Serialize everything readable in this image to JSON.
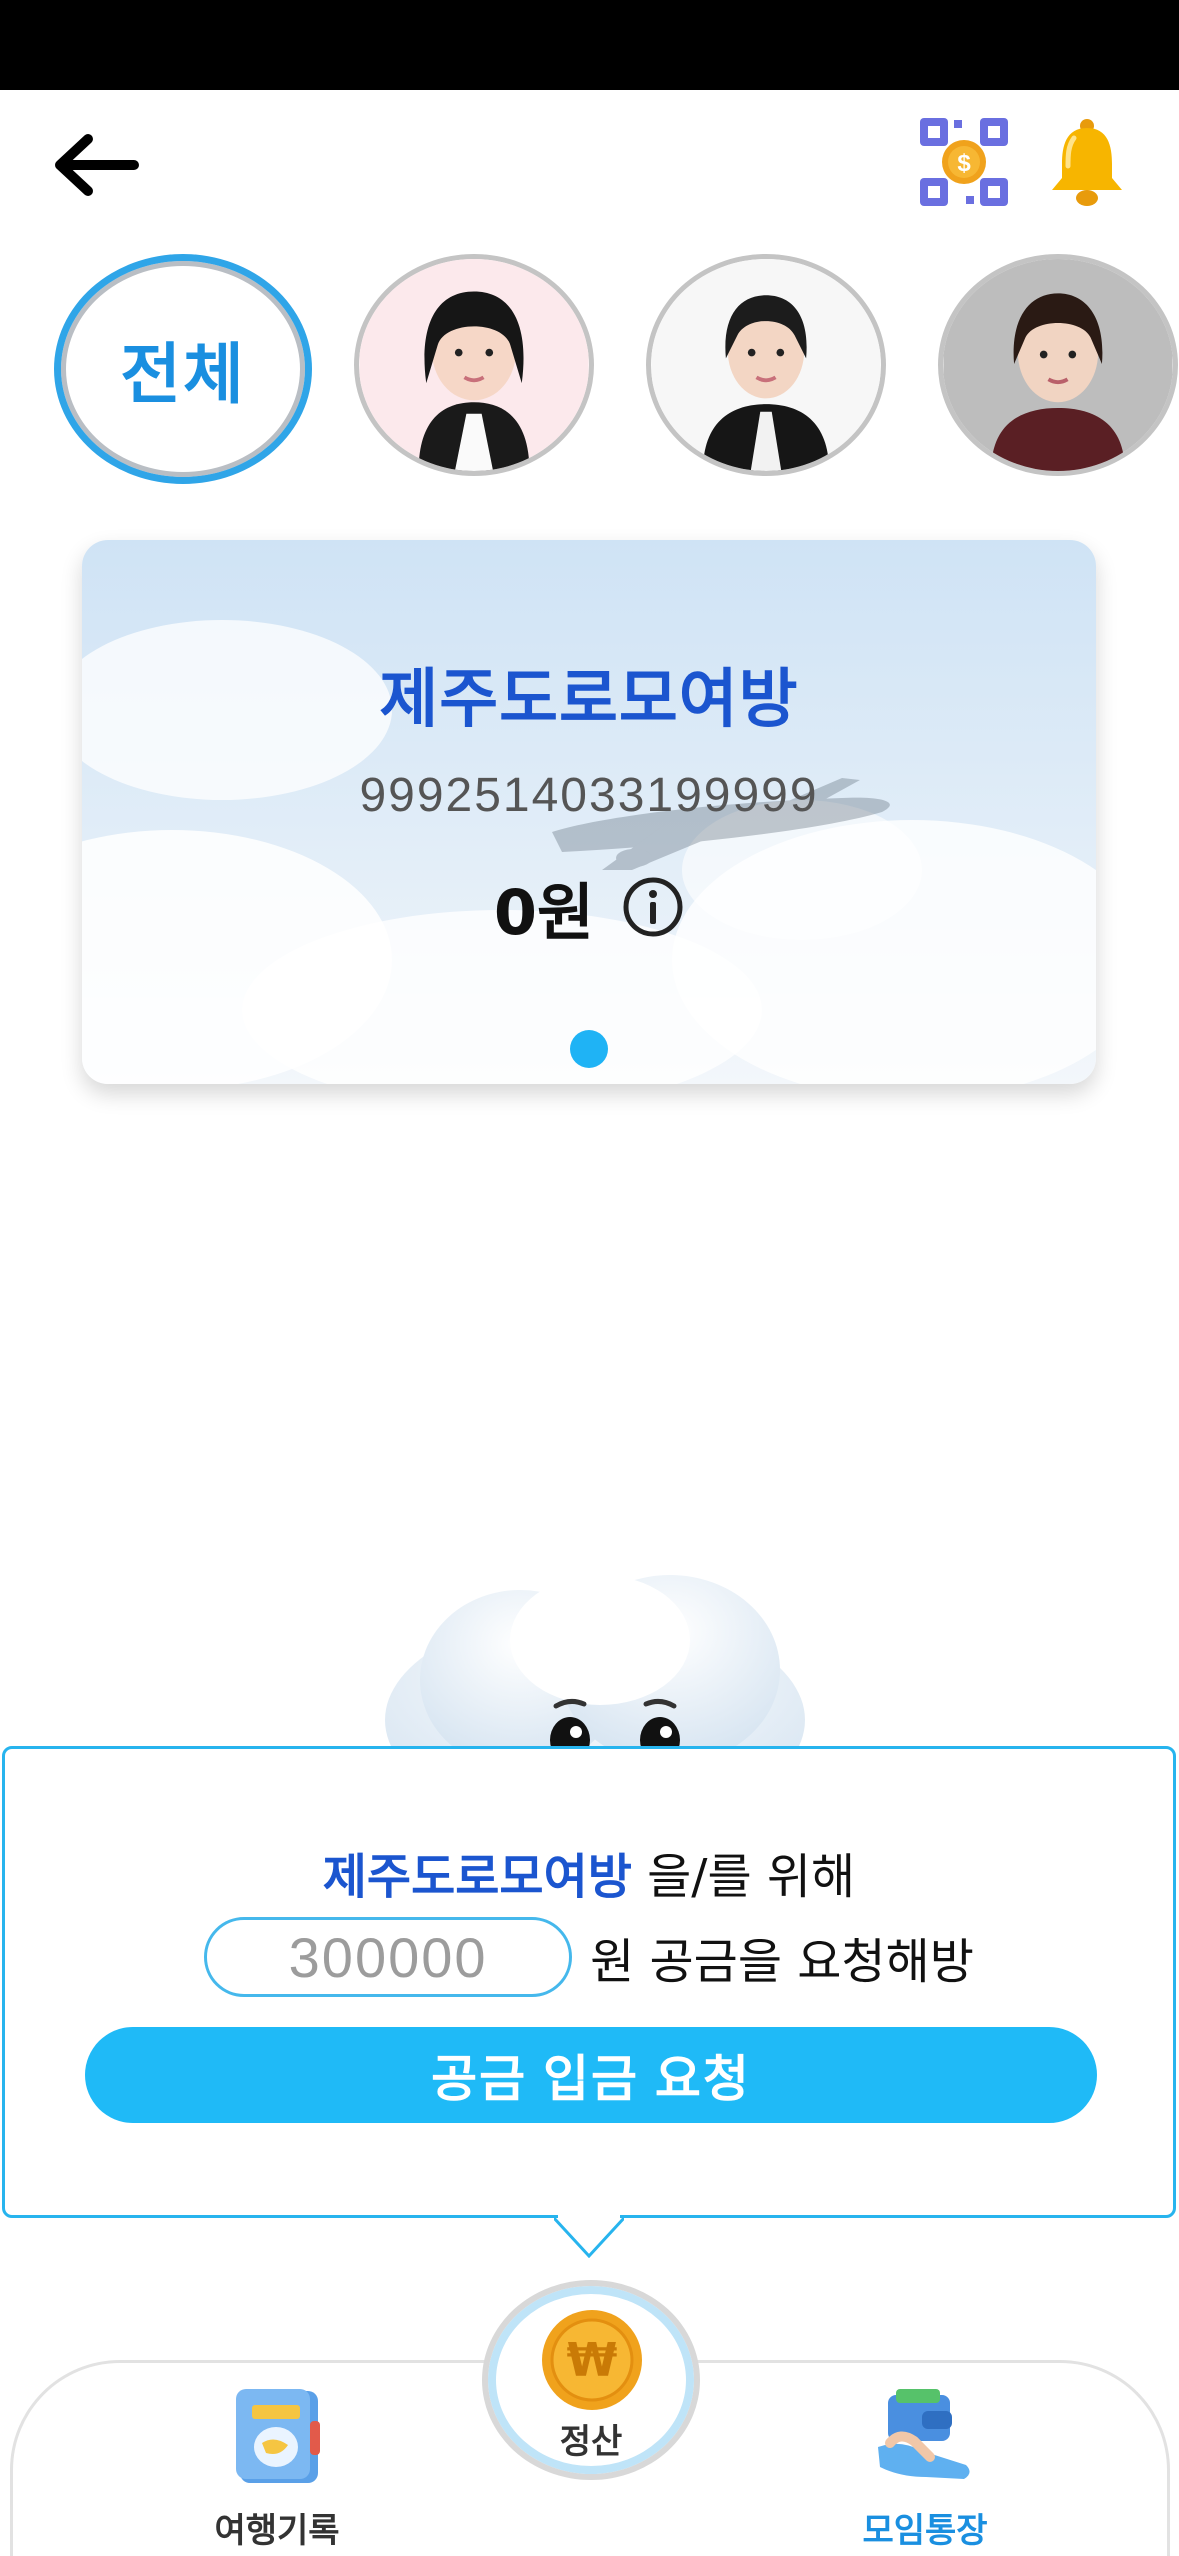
{
  "header": {
    "back_icon": "arrow-left-icon",
    "qr_icon": "qr-coin-icon",
    "bell_icon": "bell-icon"
  },
  "members": {
    "all_label": "전체",
    "photos": [
      "member-1",
      "member-2",
      "member-3"
    ]
  },
  "account_card": {
    "group_name": "제주도로모여방",
    "account_number": "9992514033199999",
    "balance": "0원",
    "info_icon": "info-icon"
  },
  "request": {
    "group_name": "제주도로모여방",
    "for_text": " 을/를 위해",
    "amount_value": "300000",
    "amount_suffix": "원 공금을 요청해방",
    "button_label": "공금 입금 요청"
  },
  "nav": {
    "record_label": "여행기록",
    "settle_label": "정산",
    "account_label": "모임통장"
  },
  "colors": {
    "brand_blue": "#1b55cf",
    "accent_cyan": "#1fbaf7",
    "active_tab": "#1a8fe0"
  }
}
